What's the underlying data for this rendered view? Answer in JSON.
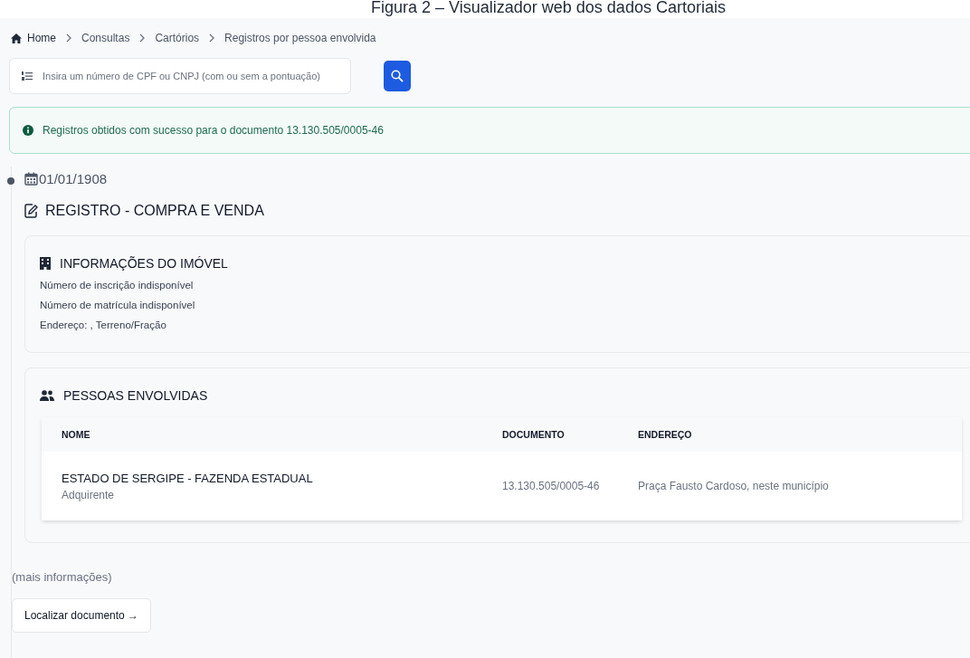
{
  "caption": "Figura 2 – Visualizador web dos dados Cartoriais",
  "breadcrumb": [
    {
      "label": "Home",
      "kind": "home"
    },
    {
      "label": "Consultas",
      "kind": "link"
    },
    {
      "label": "Cartórios",
      "kind": "link"
    },
    {
      "label": "Registros por pessoa envolvida",
      "kind": "current"
    }
  ],
  "search": {
    "placeholder": "Insira um número de CPF ou CNPJ (com ou sem a pontuação)"
  },
  "alert": {
    "text": "Registros obtidos com sucesso para o documento 13.130.505/0005-46"
  },
  "entry": {
    "date": "01/01/1908",
    "title": "REGISTRO - COMPRA E VENDA",
    "property": {
      "title": "INFORMAÇÕES DO IMÓVEL",
      "lines": [
        "Número de inscrição indisponível",
        "Número de matrícula indisponível",
        "Endereço: , Terreno/Fração"
      ]
    },
    "people": {
      "title": "PESSOAS ENVOLVIDAS",
      "columns": [
        "NOME",
        "DOCUMENTO",
        "ENDEREÇO"
      ],
      "rows": [
        {
          "name": "ESTADO DE SERGIPE - FAZENDA ESTADUAL",
          "role": "Adquirente",
          "document": "13.130.505/0005-46",
          "address": "Praça Fausto Cardoso, neste município"
        }
      ]
    },
    "more": "(mais informações)",
    "button": "Localizar documento →"
  }
}
